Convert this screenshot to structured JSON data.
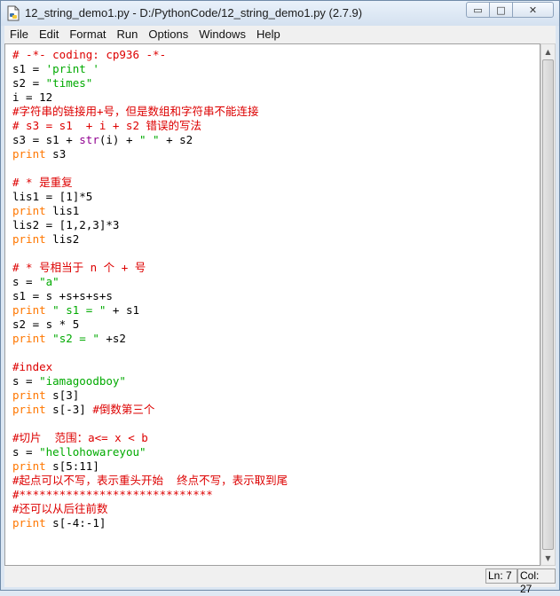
{
  "window": {
    "title": "12_string_demo1.py - D:/PythonCode/12_string_demo1.py (2.7.9)",
    "minimize_glyph": "▭",
    "maximize_glyph": "□",
    "close_glyph": "✕"
  },
  "menu": [
    "File",
    "Edit",
    "Format",
    "Run",
    "Options",
    "Windows",
    "Help"
  ],
  "editor": {
    "lines": [
      [
        {
          "t": "# -*- coding: cp936 -*-",
          "c": "c"
        }
      ],
      [
        {
          "t": "s1 = ",
          "c": ""
        },
        {
          "t": "'print '",
          "c": "s"
        }
      ],
      [
        {
          "t": "s2 = ",
          "c": ""
        },
        {
          "t": "\"times\"",
          "c": "s"
        }
      ],
      [
        {
          "t": "i = 12",
          "c": ""
        }
      ],
      [
        {
          "t": "#字符串的链接用+号，但是数组和字符串不能连接",
          "c": "c"
        }
      ],
      [
        {
          "t": "# s3 = s1  + i + s2 错误的写法",
          "c": "c"
        }
      ],
      [
        {
          "t": "s3 = s1 + ",
          "c": ""
        },
        {
          "t": "str",
          "c": "b"
        },
        {
          "t": "(i) + ",
          "c": ""
        },
        {
          "t": "\" \"",
          "c": "s"
        },
        {
          "t": " + s2",
          "c": ""
        }
      ],
      [
        {
          "t": "print",
          "c": "k"
        },
        {
          "t": " s3",
          "c": ""
        }
      ],
      [
        {
          "t": "",
          "c": ""
        }
      ],
      [
        {
          "t": "# * 是重复",
          "c": "c"
        }
      ],
      [
        {
          "t": "lis1 = [1]*5",
          "c": ""
        }
      ],
      [
        {
          "t": "print",
          "c": "k"
        },
        {
          "t": " lis1",
          "c": ""
        }
      ],
      [
        {
          "t": "lis2 = [1,2,3]*3",
          "c": ""
        }
      ],
      [
        {
          "t": "print",
          "c": "k"
        },
        {
          "t": " lis2",
          "c": ""
        }
      ],
      [
        {
          "t": "",
          "c": ""
        }
      ],
      [
        {
          "t": "# * 号相当于 n 个 + 号",
          "c": "c"
        }
      ],
      [
        {
          "t": "s = ",
          "c": ""
        },
        {
          "t": "\"a\"",
          "c": "s"
        }
      ],
      [
        {
          "t": "s1 = s +s+s+s+s",
          "c": ""
        }
      ],
      [
        {
          "t": "print",
          "c": "k"
        },
        {
          "t": " ",
          "c": ""
        },
        {
          "t": "\" s1 = \"",
          "c": "s"
        },
        {
          "t": " + s1",
          "c": ""
        }
      ],
      [
        {
          "t": "s2 = s * 5",
          "c": ""
        }
      ],
      [
        {
          "t": "print",
          "c": "k"
        },
        {
          "t": " ",
          "c": ""
        },
        {
          "t": "\"s2 = \"",
          "c": "s"
        },
        {
          "t": " +s2",
          "c": ""
        }
      ],
      [
        {
          "t": "",
          "c": ""
        }
      ],
      [
        {
          "t": "#index",
          "c": "c"
        }
      ],
      [
        {
          "t": "s = ",
          "c": ""
        },
        {
          "t": "\"iamagoodboy\"",
          "c": "s"
        }
      ],
      [
        {
          "t": "print",
          "c": "k"
        },
        {
          "t": " s[3]",
          "c": ""
        }
      ],
      [
        {
          "t": "print",
          "c": "k"
        },
        {
          "t": " s[-3] ",
          "c": ""
        },
        {
          "t": "#倒数第三个",
          "c": "c"
        }
      ],
      [
        {
          "t": "",
          "c": ""
        }
      ],
      [
        {
          "t": "#切片  范围：a<= x < b",
          "c": "c"
        }
      ],
      [
        {
          "t": "s = ",
          "c": ""
        },
        {
          "t": "\"hellohowareyou\"",
          "c": "s"
        }
      ],
      [
        {
          "t": "print",
          "c": "k"
        },
        {
          "t": " s[5:11]",
          "c": ""
        }
      ],
      [
        {
          "t": "#起点可以不写，表示重头开始  终点不写，表示取到尾",
          "c": "c"
        }
      ],
      [
        {
          "t": "#*****************************",
          "c": "c"
        }
      ],
      [
        {
          "t": "#还可以从后往前数",
          "c": "c"
        }
      ],
      [
        {
          "t": "print",
          "c": "k"
        },
        {
          "t": " s[-4:-1]",
          "c": ""
        }
      ]
    ]
  },
  "status": {
    "ln": "Ln: 7",
    "col": "Col: 27"
  },
  "colors": {
    "comment": "#dd0000",
    "string": "#00aa00",
    "keyword": "#ff7700",
    "builtin": "#900090"
  },
  "icons": {
    "app": "python-idle-icon",
    "scroll_up": "scroll-up-arrow-icon",
    "scroll_down": "scroll-down-arrow-icon"
  }
}
